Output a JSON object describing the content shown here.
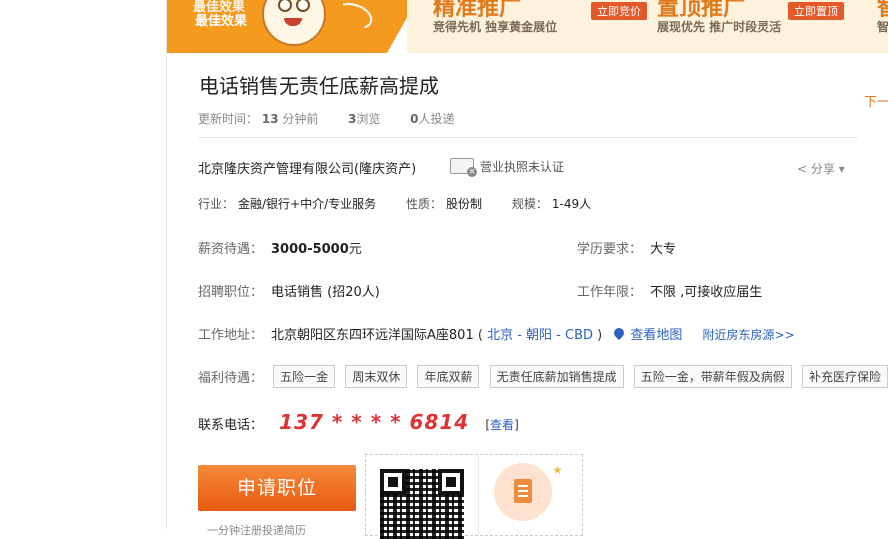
{
  "banner": {
    "left_line1": "最佳效果",
    "left_line2": "最佳效果",
    "ad1": {
      "head": "精准推广",
      "sub": "竞得先机 独享黄金展位",
      "button": "立即竞价"
    },
    "ad2": {
      "head": "置顶推广",
      "sub": "展现优先 推广时段灵活",
      "button": "立即置顶"
    },
    "ad3": {
      "head": "智",
      "sub": "智"
    }
  },
  "job": {
    "title": "电话销售无责任底薪高提成",
    "next_link": "下一",
    "meta": {
      "updated_label": "更新时间：",
      "updated_value": "13",
      "updated_unit": "分钟前",
      "views_value": "3",
      "views_unit": "浏览",
      "applies_value": "0",
      "applies_unit": "人投递"
    }
  },
  "company": {
    "name": "北京隆庆资产管理有限公司(隆庆资产)",
    "license": "营业执照未认证",
    "share": "分享",
    "industry_label": "行业：",
    "industry_value": "金融/银行+中介/专业服务",
    "nature_label": "性质：",
    "nature_value": "股份制",
    "scale_label": "规模：",
    "scale_value": "1-49人"
  },
  "details": {
    "salary_label": "薪资待遇：",
    "salary_value": "3000-5000",
    "salary_unit": "元",
    "education_label": "学历要求：",
    "education_value": "大专",
    "position_label": "招聘职位：",
    "position_value": "电话销售 (招20人)",
    "experience_label": "工作年限：",
    "experience_value": "不限 ,可接收应届生",
    "address_label": "工作地址：",
    "address_value": "北京朝阳区东四环远洋国际A座801",
    "address_area_open": "(",
    "address_area": "北京 - 朝阳 - CBD",
    "address_area_close": ")",
    "map_link": "查看地图",
    "nearby_link": "附近房东房源>>",
    "benefits_label": "福利待遇：",
    "benefits": [
      "五险一金",
      "周末双休",
      "年底双薪",
      "无责任底薪加销售提成",
      "五险一金，带薪年假及病假",
      "补充医疗保险"
    ]
  },
  "contact": {
    "label": "联系电话：",
    "number": "137 * * * * 6814",
    "view_open": "[",
    "view_link": "查看",
    "view_close": "]"
  },
  "apply": {
    "button": "申请职位",
    "note": "一分钟注册投递简历"
  }
}
